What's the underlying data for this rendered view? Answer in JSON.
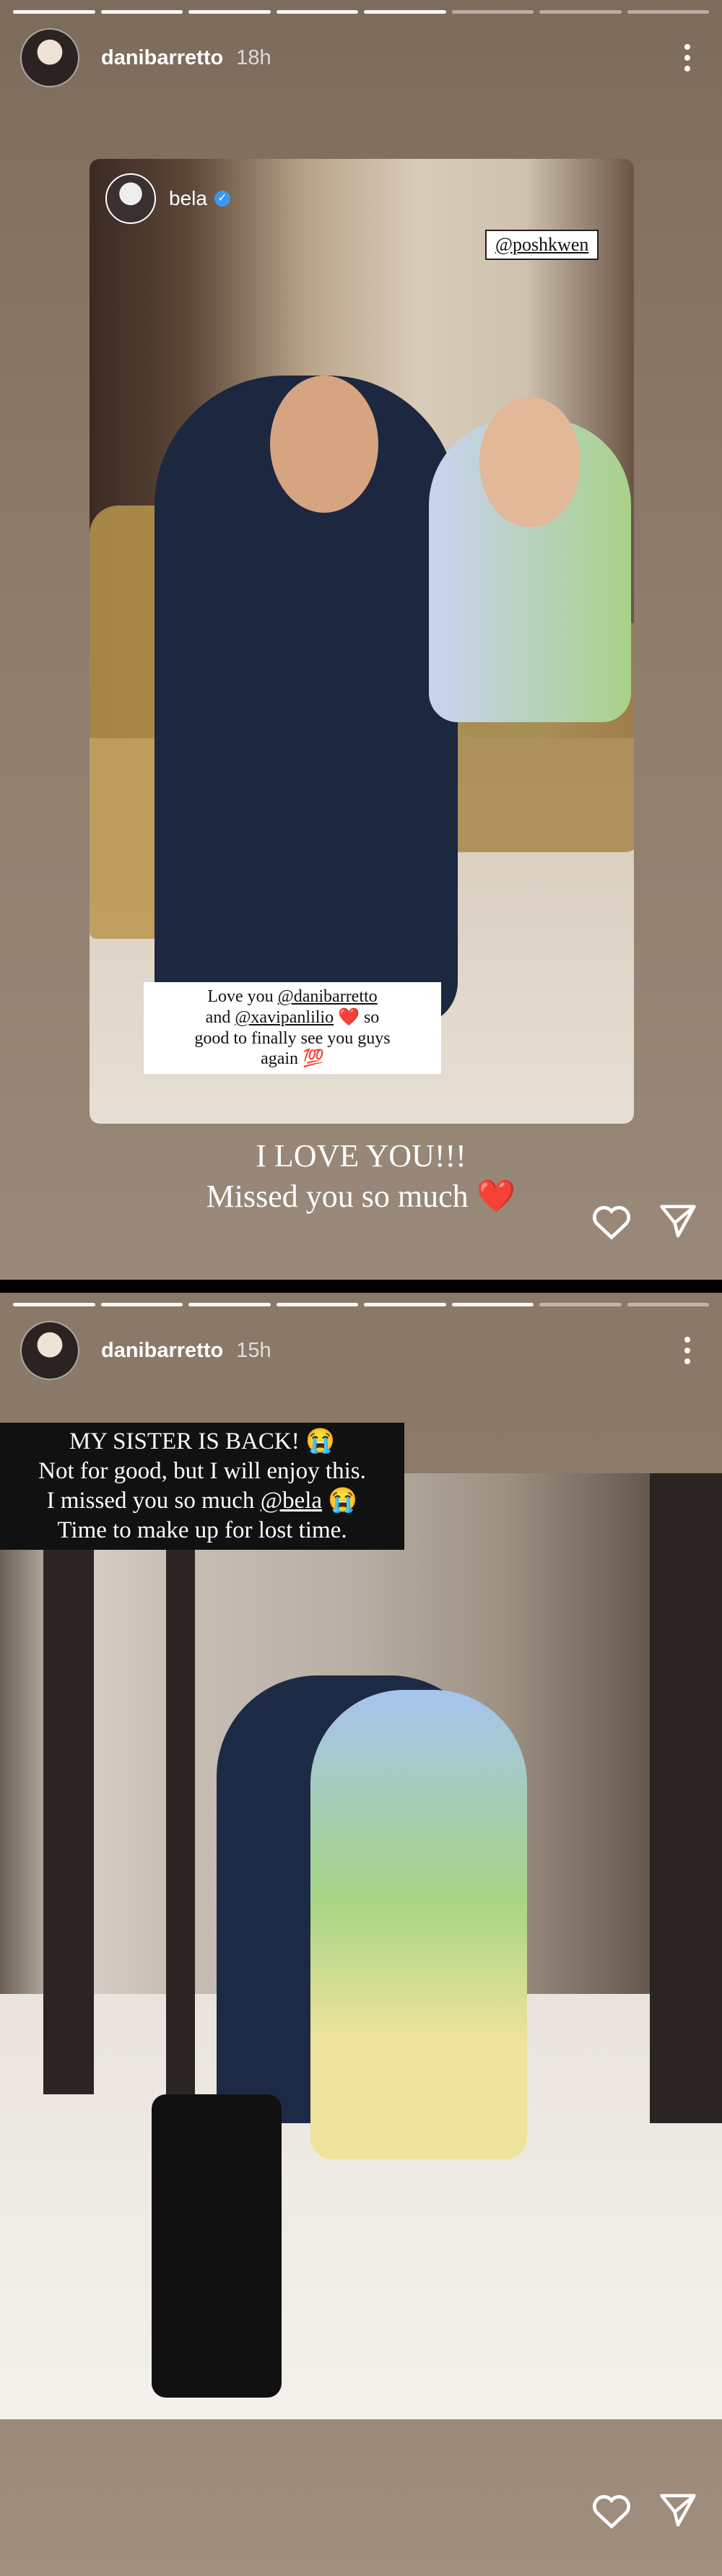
{
  "stories": [
    {
      "username": "danibarretto",
      "time": "18h",
      "repost": {
        "username": "bela",
        "mention_tag": "@poshkwen",
        "caption": {
          "line1_prefix": "Love you ",
          "mention1": "@danibarretto",
          "line2_prefix": "and ",
          "mention2": "@xavipanlilio",
          "emoji1": "❤️",
          "line2_suffix": " so",
          "line3": "good to finally see you guys",
          "line4": "again",
          "emoji2": "💯"
        }
      },
      "text_line1": "I LOVE YOU!!!",
      "text_line2": "Missed you so much",
      "text_emoji": "❤️"
    },
    {
      "username": "danibarretto",
      "time": "15h",
      "caption": {
        "line1": "MY SISTER IS BACK!",
        "line1_emoji": "😭",
        "line2": "Not for good, but I will enjoy this.",
        "line3_prefix": "I missed you so much ",
        "line3_mention": "@bela",
        "line3_emoji": "😭",
        "line4": "Time to make up for lost time."
      }
    }
  ],
  "icons": {
    "like": "heart-icon",
    "share": "send-icon",
    "more": "more-options-icon",
    "verified": "verified-badge-icon"
  },
  "colors": {
    "verified": "#3897f0",
    "heart": "#e0245e"
  }
}
